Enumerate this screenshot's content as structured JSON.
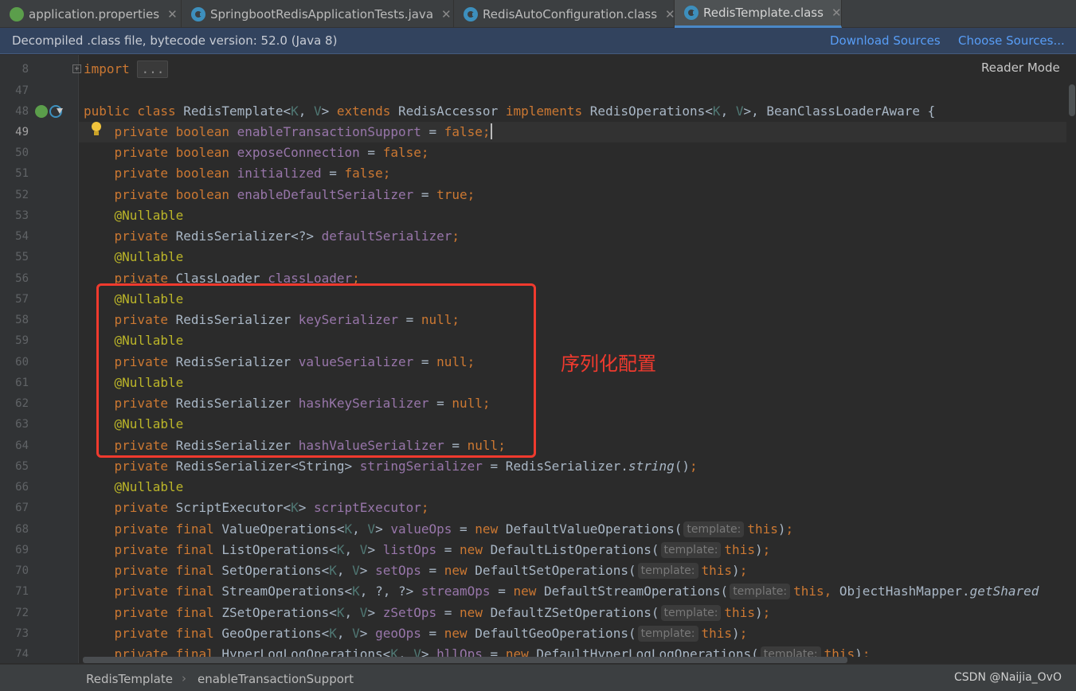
{
  "tabs": [
    {
      "label": "application.properties",
      "icon": "spring-properties-icon",
      "active": false
    },
    {
      "label": "SpringbootRedisApplicationTests.java",
      "icon": "class-icon",
      "active": false
    },
    {
      "label": "RedisAutoConfiguration.class",
      "icon": "class-icon",
      "active": false
    },
    {
      "label": "RedisTemplate.class",
      "icon": "class-icon",
      "active": true
    }
  ],
  "tab_close_glyph": "✕",
  "banner": {
    "text": "Decompiled .class file, bytecode version: 52.0 (Java 8)",
    "download_sources": "Download Sources",
    "choose_sources": "Choose Sources..."
  },
  "editor": {
    "reader_mode": "Reader Mode",
    "fold_placeholder": "...",
    "current_line": "49",
    "line_numbers": [
      "8",
      "47",
      "48",
      "49",
      "50",
      "51",
      "52",
      "53",
      "54",
      "55",
      "56",
      "57",
      "58",
      "59",
      "60",
      "61",
      "62",
      "63",
      "64",
      "65",
      "66",
      "67",
      "68",
      "69",
      "70",
      "71",
      "72",
      "73",
      "74"
    ]
  },
  "annotation": {
    "label": "序列化配置",
    "color": "#f03a2e"
  },
  "breadcrumb": {
    "class_name": "RedisTemplate",
    "separator": "›",
    "member": "enableTransactionSupport"
  },
  "watermark": "CSDN @Naijia_OvO",
  "colors": {
    "keyword": "#cc7832",
    "field": "#9876aa",
    "annotation": "#bbb529",
    "type_param": "#507874",
    "link": "#589df6",
    "background": "#2b2b2b"
  }
}
